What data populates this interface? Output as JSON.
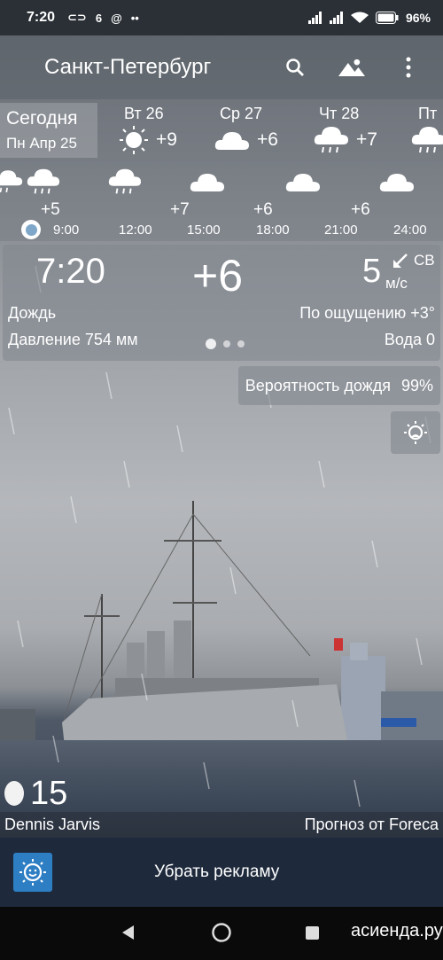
{
  "status_bar": {
    "time": "7:20",
    "left_icons": [
      "link-icon",
      "6",
      "at-icon",
      "dots-icon"
    ],
    "battery": "96%"
  },
  "app_bar": {
    "city": "Санкт-Петербург",
    "actions": [
      "search-icon",
      "landscape-icon",
      "more-vert-icon"
    ]
  },
  "days": {
    "today": {
      "label": "Сегодня",
      "date": "Пн Апр 25"
    },
    "items": [
      {
        "name": "Вт 26",
        "icon": "sun-icon",
        "temp": "+9"
      },
      {
        "name": "Ср 27",
        "icon": "cloud-icon",
        "temp": "+6"
      },
      {
        "name": "Чт 28",
        "icon": "rain-cloud-icon",
        "temp": "+7"
      },
      {
        "name": "Пт",
        "icon": "rain-cloud-icon",
        "temp": ""
      }
    ]
  },
  "hourly": {
    "temps": [
      "+5",
      "+7",
      "+6",
      "+6"
    ],
    "times": [
      "9:00",
      "12:00",
      "15:00",
      "18:00",
      "21:00",
      "24:00"
    ]
  },
  "current": {
    "time": "7:20",
    "temp": "+6",
    "wind_speed": "5",
    "wind_dir": "СВ",
    "wind_unit": "м/с",
    "condition": "Дождь",
    "feels_like": "По ощущению +3°",
    "pressure": "Давление 754 мм",
    "water": "Вода 0",
    "page_index": 0,
    "page_count": 3
  },
  "rain_probability": {
    "label": "Вероятность дождя",
    "value": "99%"
  },
  "moon": {
    "day": "15"
  },
  "credits": {
    "photo_author": "Dennis Jarvis",
    "source": "Прогноз от Foreca"
  },
  "ad": {
    "label": "Убрать рекламу"
  },
  "watermark": "асиенда.ру",
  "colors": {
    "ad_bar": "#1e2a3c",
    "ad_icon": "#2e7ec4",
    "status_bar": "#2b3036"
  }
}
